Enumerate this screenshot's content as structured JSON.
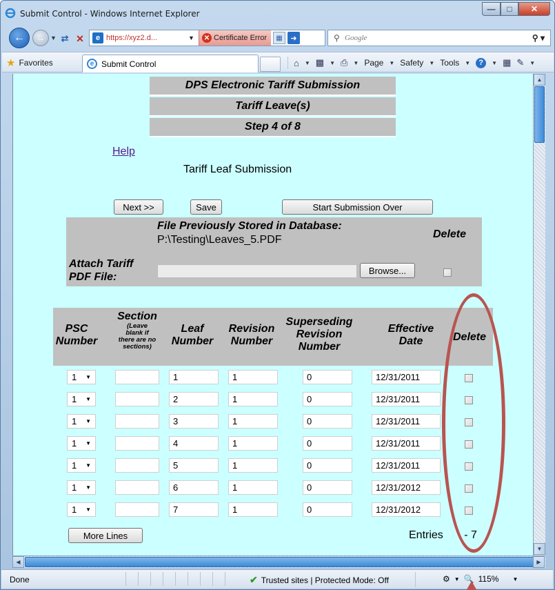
{
  "window": {
    "title": "Submit Control - Windows Internet Explorer"
  },
  "nav": {
    "url": "https://xyz2.d...",
    "cert_error": "Certificate Error",
    "search_placeholder": "Google"
  },
  "favbar": {
    "favorites": "Favorites",
    "tab_title": "Submit Control",
    "page_menu": "Page",
    "safety_menu": "Safety",
    "tools_menu": "Tools"
  },
  "page": {
    "headers": [
      "DPS Electronic Tariff Submission",
      "Tariff Leave(s)",
      "Step 4 of 8"
    ],
    "help_link": "Help",
    "subtitle": "Tariff Leaf Submission",
    "buttons": {
      "next": "Next >>",
      "save": "Save",
      "start_over": "Start Submission Over",
      "browse": "Browse...",
      "more_lines": "More Lines"
    },
    "attach": {
      "stored_label": "File Previously Stored in Database:",
      "stored_path": "P:\\Testing\\Leaves_5.PDF",
      "delete_header": "Delete",
      "attach_label_1": "Attach Tariff",
      "attach_label_2": "PDF File:"
    },
    "table": {
      "columns": {
        "psc": [
          "PSC",
          "Number"
        ],
        "section": "Section",
        "section_note": [
          "(Leave",
          "blank if",
          "there are no",
          "sections)"
        ],
        "leaf": [
          "Leaf",
          "Number"
        ],
        "revision": [
          "Revision",
          "Number"
        ],
        "superseding": [
          "Superseding",
          "Revision",
          "Number"
        ],
        "effective": [
          "Effective",
          "Date"
        ],
        "delete": "Delete"
      },
      "rows": [
        {
          "psc": "1",
          "section": "",
          "leaf": "1",
          "revision": "1",
          "superseding": "0",
          "effective": "12/31/2011"
        },
        {
          "psc": "1",
          "section": "",
          "leaf": "2",
          "revision": "1",
          "superseding": "0",
          "effective": "12/31/2011"
        },
        {
          "psc": "1",
          "section": "",
          "leaf": "3",
          "revision": "1",
          "superseding": "0",
          "effective": "12/31/2011"
        },
        {
          "psc": "1",
          "section": "",
          "leaf": "4",
          "revision": "1",
          "superseding": "0",
          "effective": "12/31/2011"
        },
        {
          "psc": "1",
          "section": "",
          "leaf": "5",
          "revision": "1",
          "superseding": "0",
          "effective": "12/31/2011"
        },
        {
          "psc": "1",
          "section": "",
          "leaf": "6",
          "revision": "1",
          "superseding": "0",
          "effective": "12/31/2012"
        },
        {
          "psc": "1",
          "section": "",
          "leaf": "7",
          "revision": "1",
          "superseding": "0",
          "effective": "12/31/2012"
        }
      ]
    },
    "entries_label": "Entries",
    "entries_value": "- 7"
  },
  "status": {
    "done": "Done",
    "zone": "Trusted sites | Protected Mode: Off",
    "zoom": "115%"
  },
  "colors": {
    "page_bg": "#ccffff",
    "header_gray": "#c0c0c0",
    "annotation": "#b85450",
    "visited_link": "#551a8b"
  },
  "icons": [
    "ie-logo-icon",
    "back-arrow-icon",
    "forward-arrow-icon",
    "refresh-icon",
    "stop-icon",
    "certificate-error-icon",
    "search-icon",
    "favorites-star-icon",
    "home-icon",
    "print-icon",
    "help-icon",
    "check-icon",
    "zoom-icon"
  ]
}
